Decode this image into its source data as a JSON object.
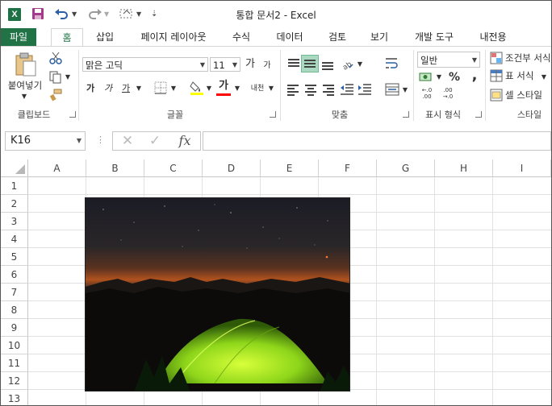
{
  "window": {
    "title": "통합 문서2 - Excel",
    "app_logo": "X"
  },
  "qat": {
    "save_icon": "save-icon",
    "undo_icon": "undo-icon",
    "redo_icon": "redo-icon",
    "customize_icon": "touch-mode-icon",
    "more_icon": "customize-qat-icon"
  },
  "ribbon_tabs": [
    "파일",
    "홈",
    "삽입",
    "페이지 레이아웃",
    "수식",
    "데이터",
    "검토",
    "보기",
    "개발 도구",
    "내전용"
  ],
  "active_tab": "홈",
  "clipboard": {
    "paste_label": "붙여넣기",
    "group_label": "클립보드"
  },
  "font": {
    "name": "맑은 고딕",
    "size": "11",
    "bold": "가",
    "italic": "가",
    "underline": "가",
    "grow": "가",
    "shrink": "가",
    "font_color_glyph": "가",
    "phonetic": "내천",
    "group_label": "글꼴",
    "highlight_color": "#ffff00",
    "font_color": "#ff0000"
  },
  "alignment": {
    "group_label": "맞춤"
  },
  "number": {
    "format": "일반",
    "percent": "%",
    "comma": ",",
    "group_label": "표시 형식",
    "inc_decimal_top": "←.0",
    "inc_decimal_bottom": ".00",
    "dec_decimal_top": ".00",
    "dec_decimal_bottom": "→.0"
  },
  "styles": {
    "conditional": "조건부 서식",
    "table": "표 서식",
    "cell": "셀 스타일",
    "group_label": "스타일"
  },
  "formula_bar": {
    "name_box": "K16",
    "cancel": "✕",
    "enter": "✓",
    "fx": "fx",
    "value": ""
  },
  "columns": [
    "A",
    "B",
    "C",
    "D",
    "E",
    "F",
    "G",
    "H",
    "I"
  ],
  "rows": [
    "1",
    "2",
    "3",
    "4",
    "5",
    "6",
    "7",
    "8",
    "9",
    "10",
    "11",
    "12",
    "13"
  ],
  "picture": {
    "subject": "green-tent-under-night-sky"
  }
}
